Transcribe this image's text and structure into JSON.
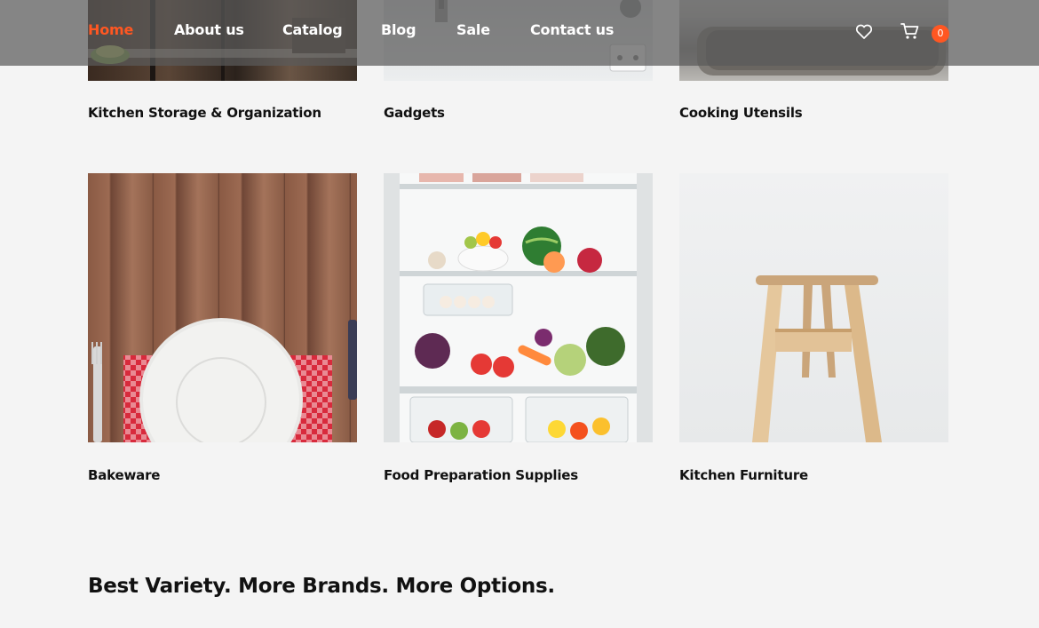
{
  "nav": {
    "items": [
      {
        "label": "Home",
        "active": true
      },
      {
        "label": "About us"
      },
      {
        "label": "Catalog"
      },
      {
        "label": "Blog"
      },
      {
        "label": "Sale"
      },
      {
        "label": "Contact us"
      }
    ],
    "wishlist_icon": "heart-icon",
    "cart_icon": "cart-icon",
    "cart_count": "0"
  },
  "categories": [
    {
      "title": "Kitchen Storage & Organization"
    },
    {
      "title": "Gadgets"
    },
    {
      "title": "Cooking Utensils"
    },
    {
      "title": "Bakeware"
    },
    {
      "title": "Food Preparation Supplies"
    },
    {
      "title": "Kitchen Furniture"
    }
  ],
  "section": {
    "heading": "Best Variety. More Brands. More Options."
  },
  "colors": {
    "accent": "#ff5722",
    "background": "#f4f4f4",
    "header_overlay": "#5a5a5a"
  }
}
